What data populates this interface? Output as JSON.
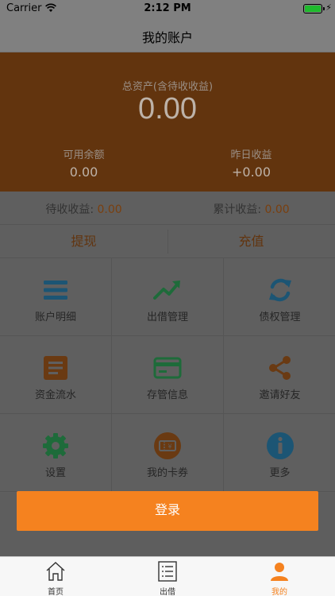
{
  "status_bar": {
    "carrier": "Carrier",
    "time": "2:12 PM"
  },
  "nav": {
    "title": "我的账户"
  },
  "hero": {
    "total_label": "总资产(含待收收益)",
    "total_value": "0.00",
    "available_label": "可用余额",
    "available_value": "0.00",
    "yesterday_label": "昨日收益",
    "yesterday_value": "+0.00"
  },
  "income": {
    "pending_label": "待收收益: ",
    "pending_value": "0.00",
    "cumulative_label": "累计收益: ",
    "cumulative_value": "0.00"
  },
  "actions": {
    "withdraw": "提现",
    "recharge": "充值"
  },
  "grid": {
    "items": [
      {
        "label": "账户明细",
        "icon": "list-icon"
      },
      {
        "label": "出借管理",
        "icon": "trend-up-icon"
      },
      {
        "label": "债权管理",
        "icon": "refresh-icon"
      },
      {
        "label": "资金流水",
        "icon": "document-icon"
      },
      {
        "label": "存管信息",
        "icon": "card-icon"
      },
      {
        "label": "邀请好友",
        "icon": "share-icon"
      },
      {
        "label": "设置",
        "icon": "gear-icon"
      },
      {
        "label": "我的卡券",
        "icon": "coupon-icon"
      },
      {
        "label": "更多",
        "icon": "info-icon"
      }
    ]
  },
  "login": {
    "label": "登录"
  },
  "tabbar": {
    "tabs": [
      {
        "label": "首页",
        "icon": "home-icon"
      },
      {
        "label": "出借",
        "icon": "list-doc-icon"
      },
      {
        "label": "我的",
        "icon": "person-icon"
      }
    ],
    "active_index": 2
  },
  "colors": {
    "accent": "#f5821f",
    "hero_bg": "#62340e",
    "green": "#1e7a3e",
    "teal": "#1c5574"
  }
}
